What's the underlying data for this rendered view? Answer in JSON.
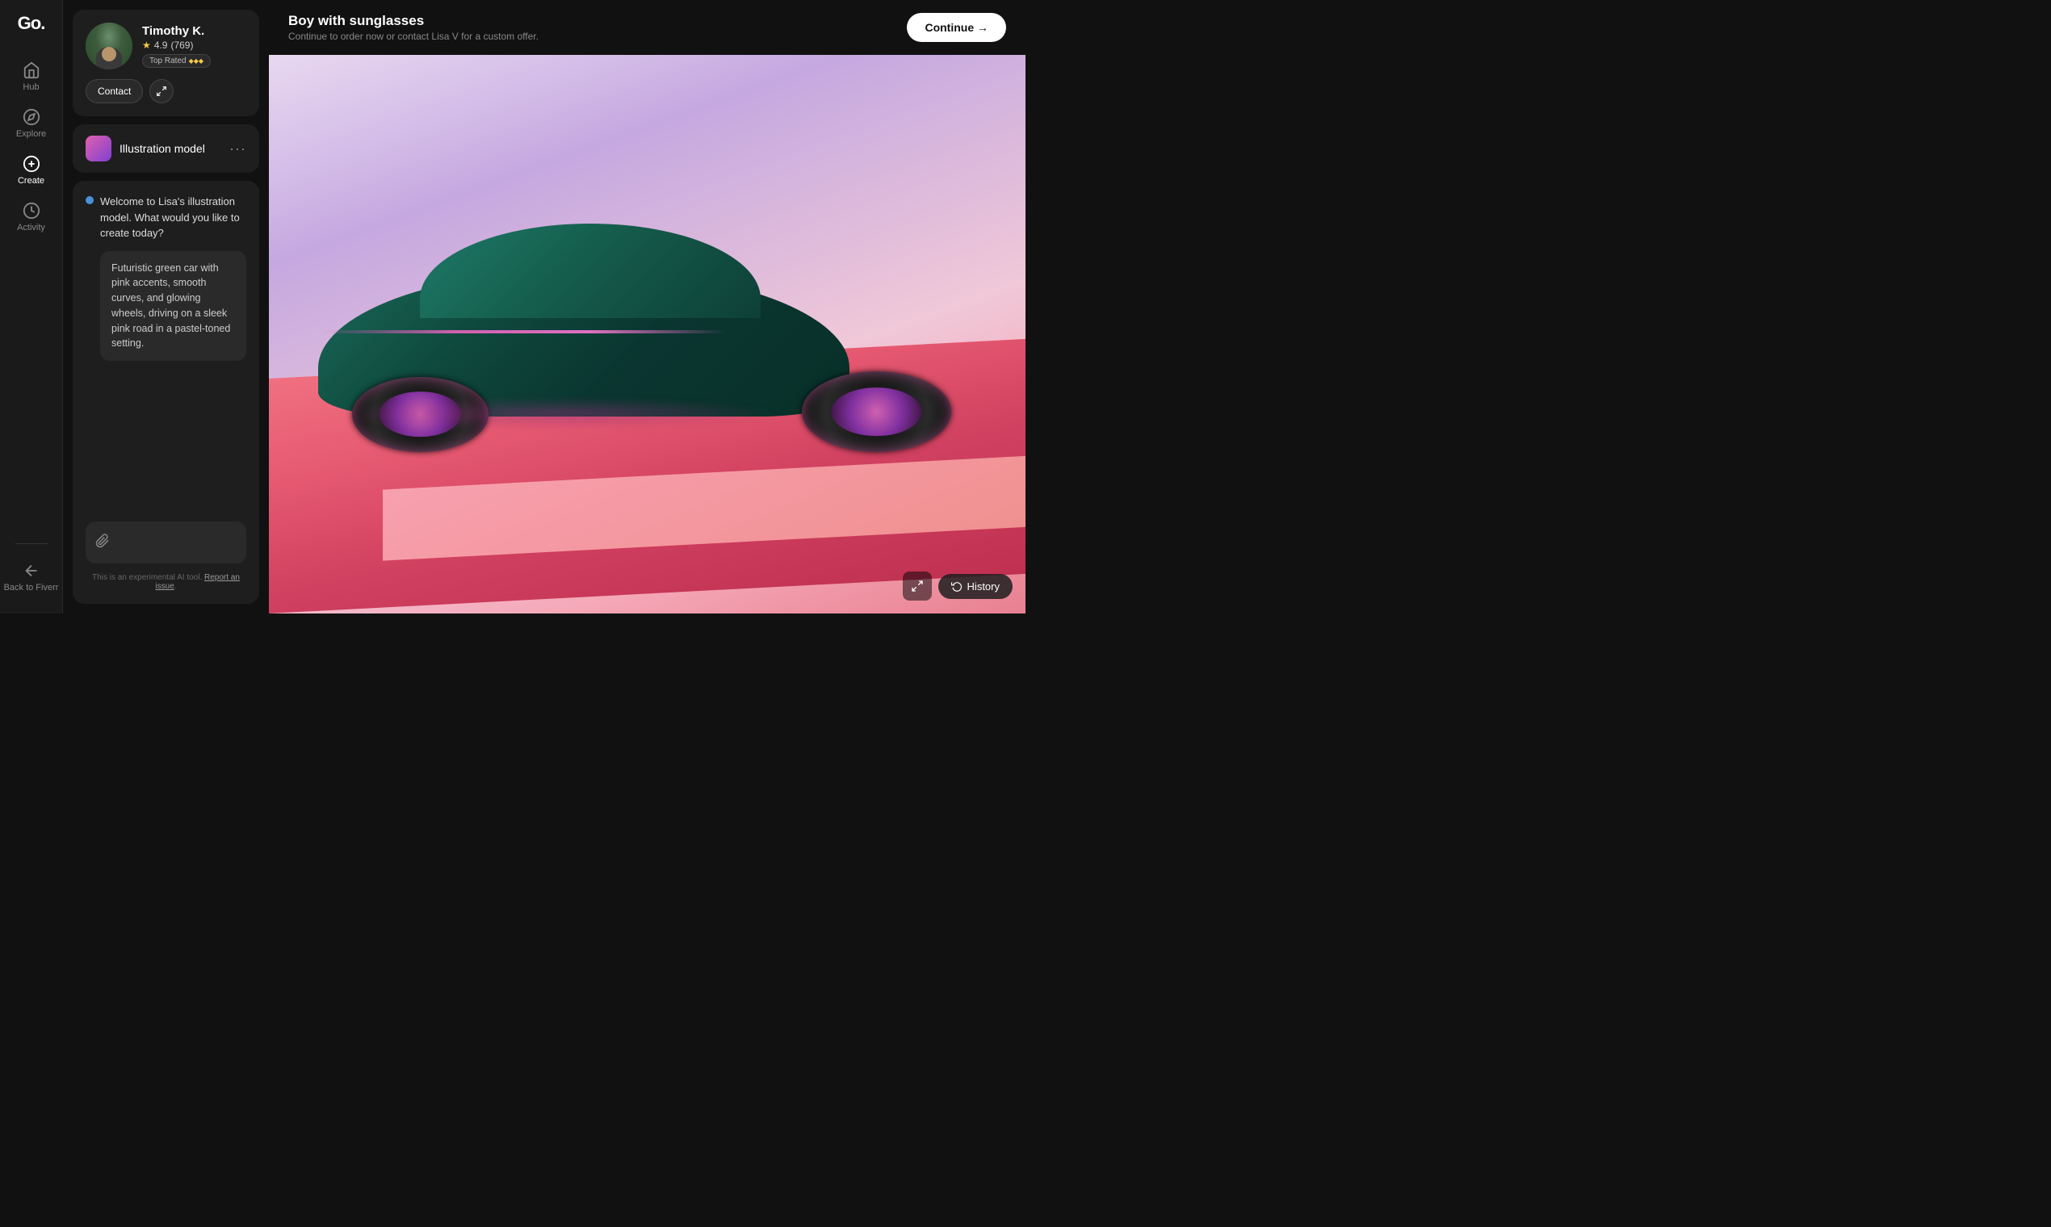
{
  "app": {
    "logo": "Go."
  },
  "sidebar": {
    "items": [
      {
        "id": "hub",
        "label": "Hub",
        "icon": "home"
      },
      {
        "id": "explore",
        "label": "Explore",
        "icon": "compass"
      },
      {
        "id": "create",
        "label": "Create",
        "icon": "plus-circle",
        "active": true
      },
      {
        "id": "activity",
        "label": "Activity",
        "icon": "clock"
      }
    ],
    "bottom_items": [
      {
        "id": "back-to-fiverr",
        "label": "Back to Fiverr",
        "icon": "arrow-left"
      }
    ]
  },
  "profile": {
    "name": "Timothy K.",
    "rating": "4.9",
    "review_count": "769",
    "badge": "Top Rated",
    "badge_dots": "◆◆◆",
    "contact_label": "Contact",
    "expand_icon": "⛶"
  },
  "model": {
    "name": "Illustration model",
    "more_icon": "..."
  },
  "chat": {
    "ai_message": "Welcome to Lisa's illustration model. What would you like to create today?",
    "user_message": "Futuristic green car with pink accents, smooth curves, and glowing wheels, driving on a sleek pink road in a pastel-toned setting.",
    "input_placeholder": "",
    "attach_icon": "📎",
    "send_icon": "↑",
    "disclaimer": "This is an experimental AI tool.",
    "report_link": "Report an issue"
  },
  "header": {
    "title": "Boy with sunglasses",
    "subtitle": "Continue to order now or contact Lisa V for a custom offer.",
    "continue_label": "Continue →"
  },
  "image_controls": {
    "fullscreen_icon": "⛶",
    "history_icon": "↺",
    "history_label": "History"
  }
}
